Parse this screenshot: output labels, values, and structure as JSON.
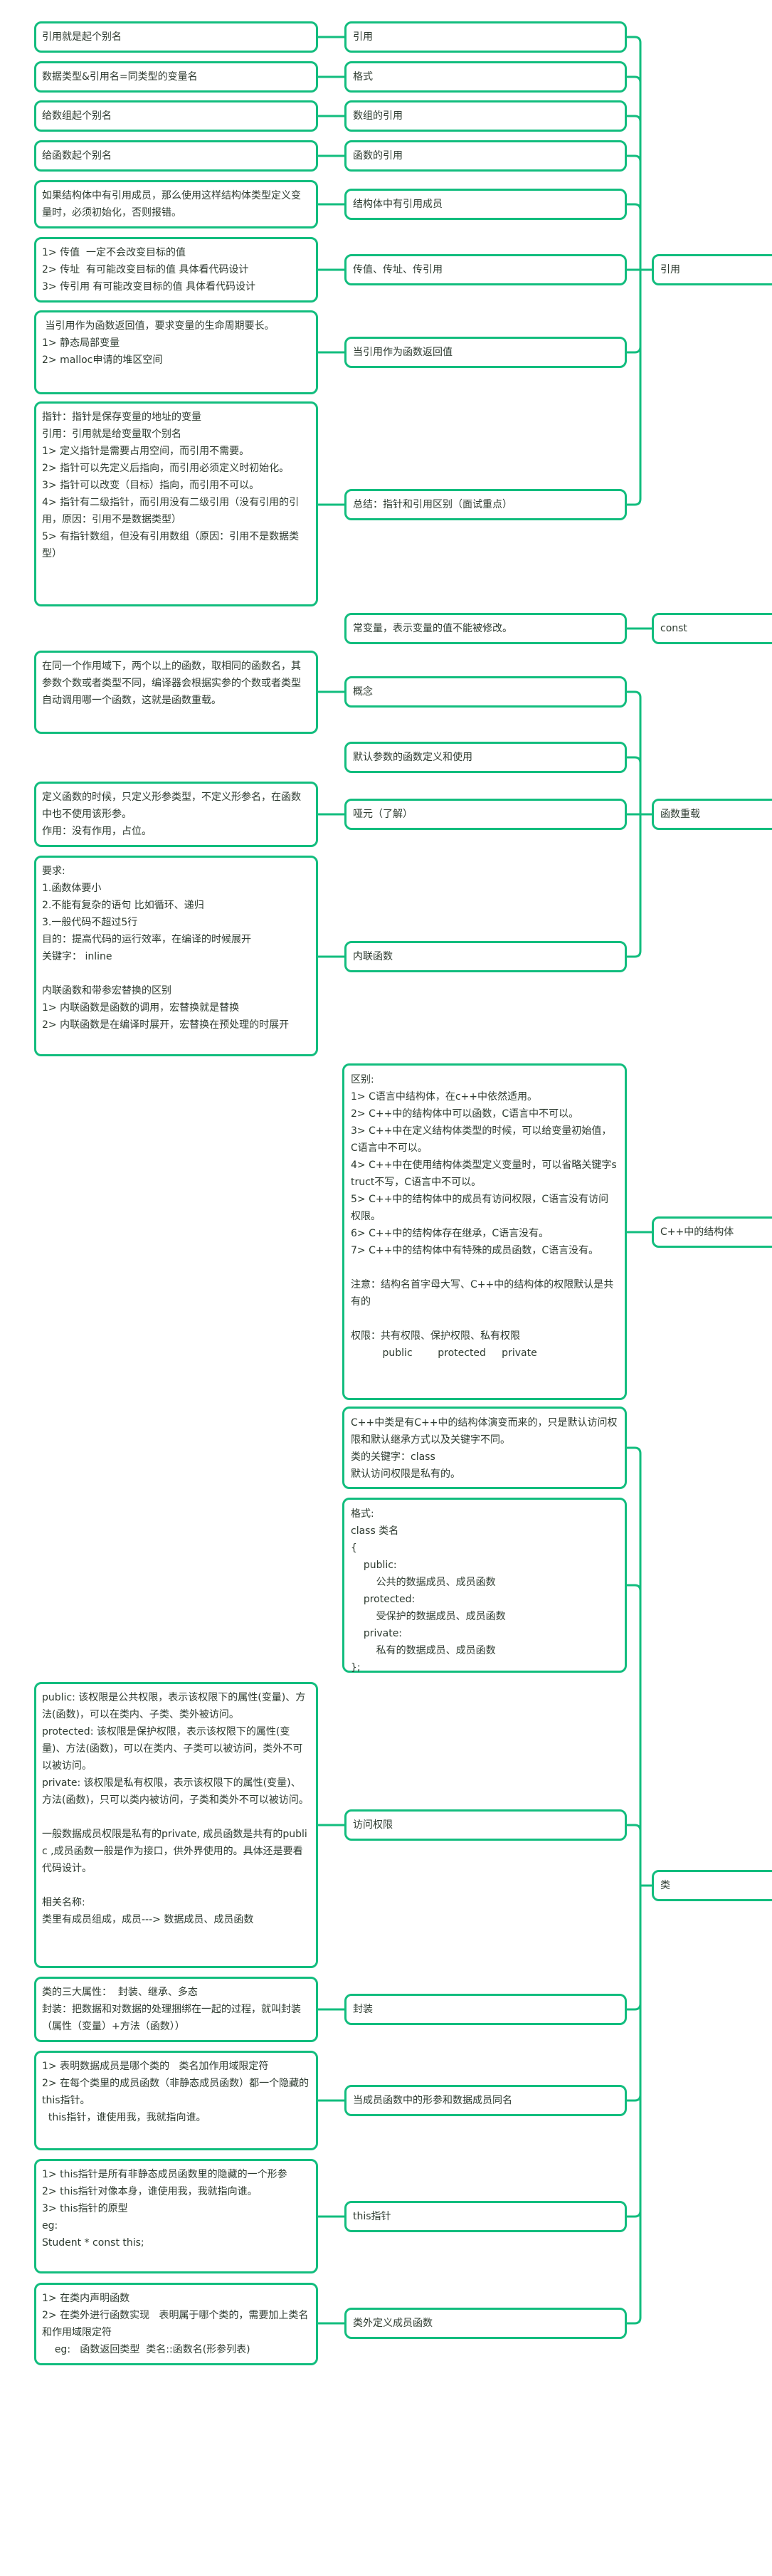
{
  "colors": {
    "border": "#12bd7e",
    "text": "#2e3b30",
    "background": "#ffffff"
  },
  "branches": [
    {
      "label": "引用",
      "topics": [
        {
          "label": "引用",
          "note": "引用就是起个别名"
        },
        {
          "label": "格式",
          "note": "数据类型&引用名=同类型的变量名"
        },
        {
          "label": "数组的引用",
          "note": "给数组起个别名"
        },
        {
          "label": "函数的引用",
          "note": "给函数起个别名"
        },
        {
          "label": "结构体中有引用成员",
          "note": "如果结构体中有引用成员，那么使用这样结构体类型定义变量时，必须初始化，否则报错。"
        },
        {
          "label": "传值、传址、传引用",
          "note": "1> 传值  一定不会改变目标的值\n2> 传址  有可能改变目标的值 具体看代码设计\n3> 传引用 有可能改变目标的值 具体看代码设计"
        },
        {
          "label": "当引用作为函数返回值",
          "note": " 当引用作为函数返回值，要求变量的生命周期要长。\n1> 静态局部变量\n2> malloc申请的堆区空间"
        },
        {
          "label": "总结：指针和引用区别（面试重点）",
          "note": "指针：指针是保存变量的地址的变量\n引用：引用就是给变量取个别名\n1> 定义指针是需要占用空间，而引用不需要。\n2> 指针可以先定义后指向，而引用必须定义时初始化。\n3> 指针可以改变（目标）指向，而引用不可以。\n4> 指针有二级指针，而引用没有二级引用（没有引用的引用，原因：引用不是数据类型）\n5> 有指针数组，但没有引用数组（原因：引用不是数据类型）"
        }
      ]
    },
    {
      "label": "const",
      "topics": [
        {
          "label": "常变量，表示变量的值不能被修改。"
        }
      ]
    },
    {
      "label": "函数重载",
      "topics": [
        {
          "label": "概念",
          "note": "在同一个作用域下，两个以上的函数，取相同的函数名，其参数个数或者类型不同，编译器会根据实参的个数或者类型自动调用哪一个函数，这就是函数重载。"
        },
        {
          "label": "默认参数的函数定义和使用"
        },
        {
          "label": "哑元（了解）",
          "note": "定义函数的时候，只定义形参类型，不定义形参名，在函数中也不使用该形参。\n作用：没有作用，占位。"
        },
        {
          "label": "内联函数",
          "note": "要求:\n1.函数体要小\n2.不能有复杂的语句 比如循环、递归\n3.一般代码不超过5行\n目的：提高代码的运行效率，在编译的时候展开\n关键字： inline\n\n内联函数和带参宏替换的区别\n1> 内联函数是函数的调用，宏替换就是替换\n2> 内联函数是在编译时展开，宏替换在预处理的时展开"
        }
      ]
    },
    {
      "label": "C++中的结构体",
      "topics": [
        {
          "note": "区别:\n1> C语言中结构体，在c++中依然适用。\n2> C++中的结构体中可以函数，C语言中不可以。\n3> C++中在定义结构体类型的时候，可以给变量初始值，C语言中不可以。\n4> C++中在使用结构体类型定义变量时，可以省略关键字struct不写，C语言中不可以。\n5> C++中的结构体中的成员有访问权限，C语言没有访问权限。\n6> C++中的结构体存在继承，C语言没有。\n7> C++中的结构体中有特殊的成员函数，C语言没有。\n\n注意：结构名首字母大写、C++中的结构体的权限默认是共有的\n\n权限：共有权限、保护权限、私有权限\n          public        protected     private"
        }
      ]
    },
    {
      "label": "类",
      "topics": [
        {
          "note": "C++中类是有C++中的结构体演变而来的，只是默认访问权限和默认继承方式以及关键字不同。\n类的关键字：class\n默认访问权限是私有的。"
        },
        {
          "note": "格式:\nclass 类名\n{\n    public:\n        公共的数据成员、成员函数\n    protected:\n        受保护的数据成员、成员函数\n    private:\n        私有的数据成员、成员函数\n};"
        },
        {
          "label": "访问权限",
          "note": "public: 该权限是公共权限，表示该权限下的属性(变量)、方法(函数)，可以在类内、子类、类外被访问。\nprotected: 该权限是保护权限，表示该权限下的属性(变量)、方法(函数)，可以在类内、子类可以被访问，类外不可以被访问。\nprivate: 该权限是私有权限，表示该权限下的属性(变量)、方法(函数)，只可以类内被访问，子类和类外不可以被访问。\n\n一般数据成员权限是私有的private, 成员函数是共有的public ,成员函数一般是作为接口，供外界使用的。具体还是要看代码设计。\n\n相关名称:\n类里有成员组成，成员---> 数据成员、成员函数"
        },
        {
          "label": "封装",
          "note": "类的三大属性：  封装、继承、多态\n封装：把数据和对数据的处理捆绑在一起的过程，就叫封装 （属性（变量）+方法（函数））"
        },
        {
          "label": "当成员函数中的形参和数据成员同名",
          "note": "1> 表明数据成员是哪个类的   类名加作用域限定符\n2> 在每个类里的成员函数（非静态成员函数）都一个隐藏的this指针。\n  this指针，谁使用我，我就指向谁。"
        },
        {
          "label": "this指针",
          "note": "1> this指针是所有非静态成员函数里的隐藏的一个形参\n2> this指针对像本身，谁使用我，我就指向谁。\n3> this指针的原型\neg:\nStudent * const this;"
        },
        {
          "label": "类外定义成员函数",
          "note": "1> 在类内声明函数\n2> 在类外进行函数实现   表明属于哪个类的，需要加上类名和作用域限定符\n    eg:   函数返回类型  类名::函数名(形参列表)"
        }
      ]
    }
  ]
}
